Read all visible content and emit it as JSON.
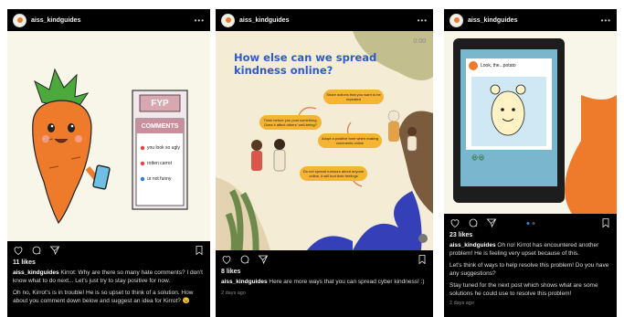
{
  "posts": [
    {
      "username": "aiss_kindguides",
      "likes": "11 likes",
      "caption_user": "aiss_kindguides",
      "caption": "Kirrot: Why are there so many hate comments? I don't know what to do next... Let's just try to stay positive for now.",
      "caption2": "Oh no, Kirrot's is in trouble! He is so upset to think of a solution. How about you comment down below and suggest an idea for Kirrot? 😉",
      "panel": {
        "fyp": "FYP",
        "comments_title": "COMMENTS",
        "comments": [
          "you look so ugly",
          "rotten carrot",
          "ur not funny"
        ]
      }
    },
    {
      "username": "aiss_kindguides",
      "likes": "8 likes",
      "caption_user": "aiss_kindguides",
      "caption": "Here are more ways that you can spread cyber kindness! :)",
      "time": "2 days ago",
      "slide": {
        "timer": "0:00",
        "title": "How else can we spread kindness online?",
        "bubbles": [
          "Think before you post something. Does it affect others' well-being?",
          "Share actions that you want to be repeated",
          "Adopt a positive tone when making comments online",
          "Do not spread rumours about anyone online, it will hurt their feelings"
        ]
      }
    },
    {
      "username": "aiss_kindguides",
      "likes": "23 likes",
      "caption_user": "aiss_kindguides",
      "caption": "Oh no! Kirrot has encountered another problem! He is feeling very upset because of this.",
      "caption2": "Let's think of ways to help resolve this problem! Do you have any suggestions?",
      "caption3": "Stay tuned for the next post which shows what are some solutions he could use to resolve this problem!",
      "time": "2 days ago",
      "screen": {
        "post_text": "Look, the...potato"
      }
    }
  ],
  "colors": {
    "carrot": "#ee7b2c",
    "leaf": "#4caa3c",
    "slide_bg": "#f5ecd6",
    "title_blue": "#2c5bd1",
    "bubble": "#f5b533",
    "blue_leaf": "#3540b8"
  },
  "icons": [
    "heart-icon",
    "comment-icon",
    "share-icon",
    "bookmark-icon",
    "more-icon"
  ]
}
